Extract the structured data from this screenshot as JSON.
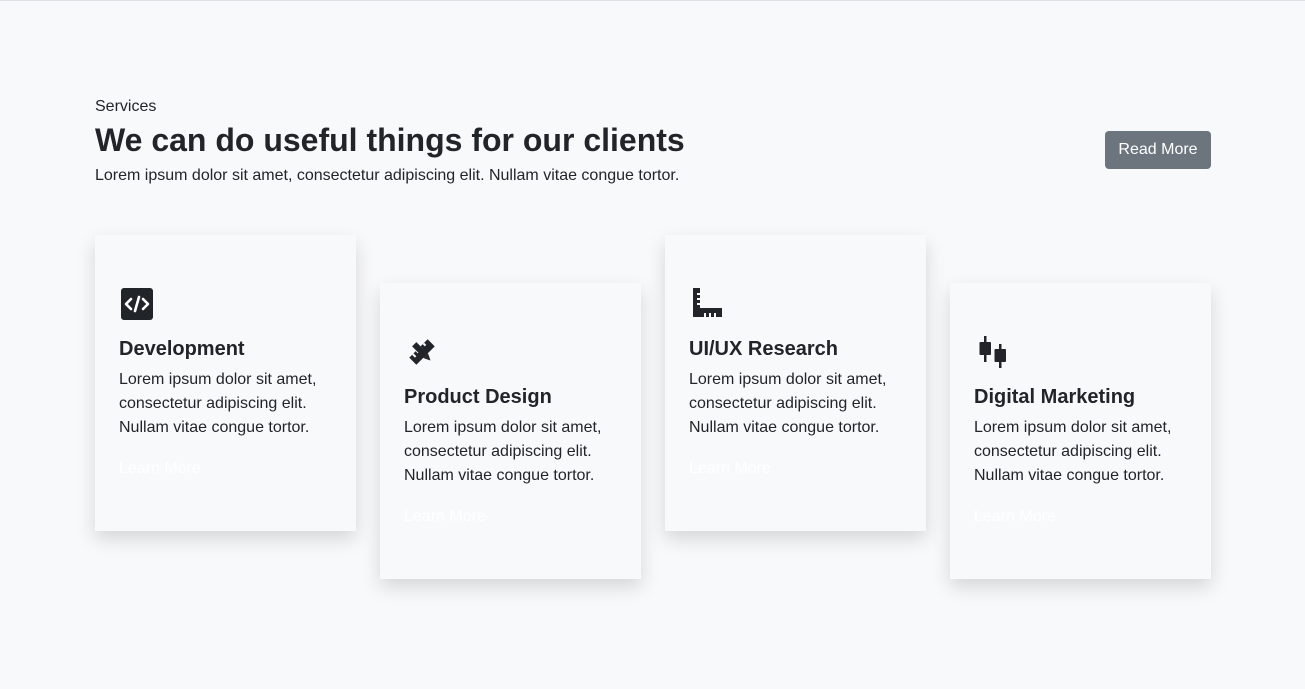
{
  "header": {
    "eyebrow": "Services",
    "heading": "We can do useful things for our clients",
    "lead": "Lorem ipsum dolor sit amet, consectetur adipiscing elit. Nullam vitae congue tortor.",
    "read_more_label": "Read More"
  },
  "cards": [
    {
      "icon": "code-square-icon",
      "title": "Development",
      "text": "Lorem ipsum dolor sit amet, consectetur adipiscing elit. Nullam vitae congue tortor.",
      "link_label": "Learn More"
    },
    {
      "icon": "pencil-ruler-icon",
      "title": "Product Design",
      "text": "Lorem ipsum dolor sit amet, consectetur adipiscing elit. Nullam vitae congue tortor.",
      "link_label": "Learn More"
    },
    {
      "icon": "rulers-icon",
      "title": "UI/UX Research",
      "text": "Lorem ipsum dolor sit amet, consectetur adipiscing elit. Nullam vitae congue tortor.",
      "link_label": "Learn More"
    },
    {
      "icon": "candlestick-chart-icon",
      "title": "Digital Marketing",
      "text": "Lorem ipsum dolor sit amet, consectetur adipiscing elit. Nullam vitae congue tortor.",
      "link_label": "Learn More"
    }
  ],
  "colors": {
    "background": "#f8f9fb",
    "text": "#212529",
    "button": "#6c757d",
    "link": "#ffffff"
  }
}
